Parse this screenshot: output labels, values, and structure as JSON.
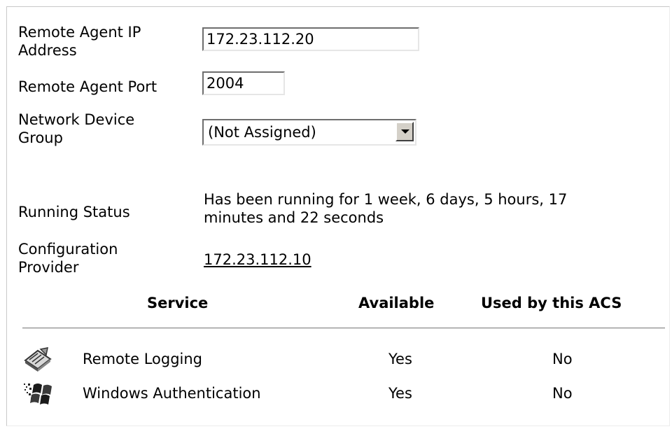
{
  "form": {
    "ip_label_line1": "Remote Agent IP",
    "ip_label_line2": "Address",
    "ip_value": "172.23.112.20",
    "port_label": "Remote Agent Port",
    "port_value": "2004",
    "group_label_line1": "Network Device",
    "group_label_line2": "Group",
    "group_selected": "(Not Assigned)",
    "status_label": "Running Status",
    "status_line1": "Has been running for 1 week, 6 days, 5 hours, 17",
    "status_line2": "minutes and 22 seconds",
    "provider_label_line1": "Configuration",
    "provider_label_line2": "Provider",
    "provider_link": "172.23.112.10"
  },
  "services": {
    "columns": [
      "Service",
      "Available",
      "Used by this ACS"
    ],
    "rows": [
      {
        "icon": "remote-logging-icon",
        "name": "Remote Logging",
        "available": "Yes",
        "used": "No"
      },
      {
        "icon": "windows-logo-icon",
        "name": "Windows Authentication",
        "available": "Yes",
        "used": "No"
      }
    ]
  }
}
